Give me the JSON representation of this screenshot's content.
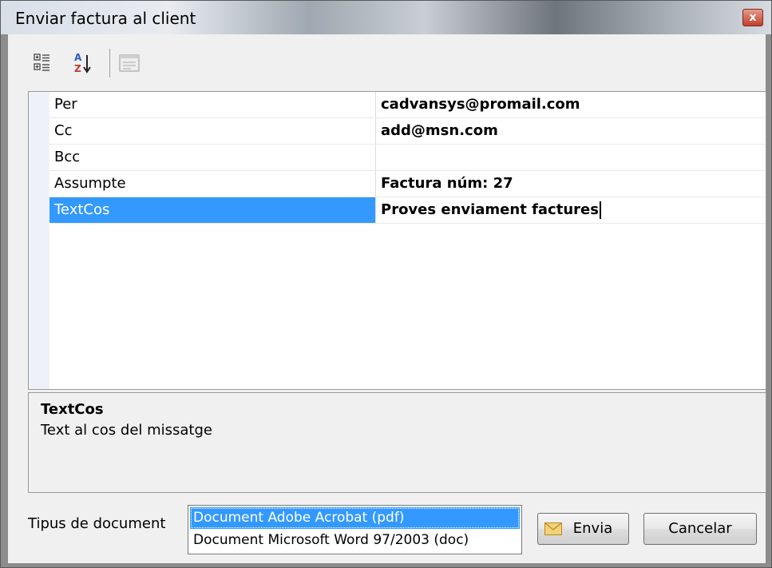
{
  "window": {
    "title": "Enviar factura al client",
    "close_glyph": "x"
  },
  "toolbar": {
    "buttons": [
      {
        "name": "categorized-view-icon",
        "tooltip": ""
      },
      {
        "name": "alphabetical-sort-icon",
        "tooltip": ""
      },
      {
        "name": "property-pages-icon",
        "tooltip": ""
      }
    ]
  },
  "properties": [
    {
      "name": "Per",
      "value": "cadvansys@promail.com",
      "selected": false
    },
    {
      "name": "Cc",
      "value": "add@msn.com",
      "selected": false
    },
    {
      "name": "Bcc",
      "value": "",
      "selected": false
    },
    {
      "name": "Assumpte",
      "value": "Factura núm: 27",
      "selected": false
    },
    {
      "name": "TextCos",
      "value": "Proves enviament factures",
      "selected": true
    }
  ],
  "help": {
    "title": "TextCos",
    "description": "Text al cos del missatge"
  },
  "document_type": {
    "label": "Tipus de document",
    "options": [
      "Document Adobe Acrobat (pdf)",
      "Document Microsoft Word 97/2003 (doc)"
    ],
    "selected_index": 0
  },
  "buttons": {
    "send": "Envia",
    "cancel": "Cancelar"
  },
  "colors": {
    "selection": "#3399ff"
  }
}
